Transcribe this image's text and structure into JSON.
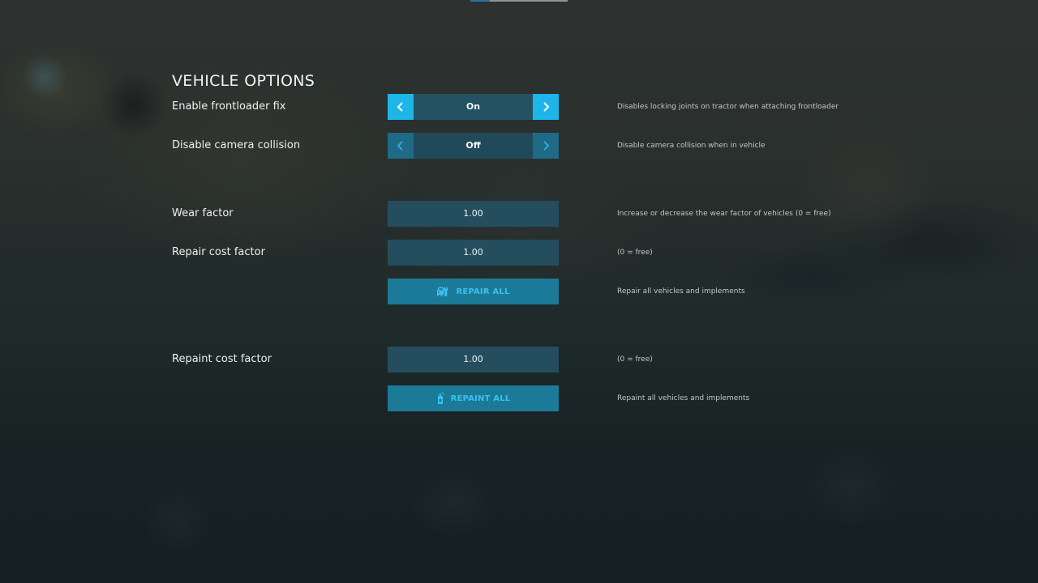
{
  "page": {
    "title": "VEHICLE OPTIONS"
  },
  "settings": [
    {
      "label": "Enable frontloader fix",
      "type": "toggle",
      "value": "On",
      "state": "active",
      "description": "Disables locking joints on tractor when attaching frontloader"
    },
    {
      "label": "Disable camera collision",
      "type": "toggle",
      "value": "Off",
      "state": "inactive",
      "description": "Disable camera collision when in vehicle"
    },
    {
      "label": "Wear factor",
      "type": "number",
      "value": "1.00",
      "description": "Increase or decrease the wear factor of vehicles (0 = free)"
    },
    {
      "label": "Repair cost factor",
      "type": "number",
      "value": "1.00",
      "description": "(0 = free)"
    },
    {
      "label": "",
      "type": "button",
      "button_label": "REPAIR ALL",
      "icon": "wrench-vehicle-icon",
      "description": "Repair all vehicles and implements"
    },
    {
      "label": "Repaint cost factor",
      "type": "number",
      "value": "1.00",
      "description": "(0 = free)"
    },
    {
      "label": "",
      "type": "button",
      "button_label": "REPAINT ALL",
      "icon": "spray-can-icon",
      "description": "Repaint all vehicles and implements"
    }
  ],
  "colors": {
    "accent": "#1eb6e8",
    "accent_dim": "#1e6a87",
    "field_bg": "#244e5e",
    "button_bg": "#1c7a99",
    "button_text": "#39c0ee"
  }
}
